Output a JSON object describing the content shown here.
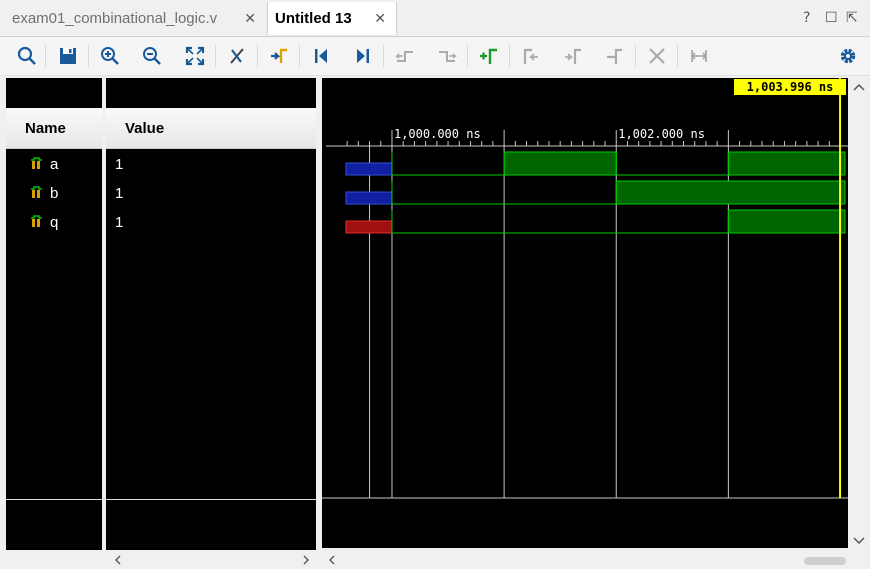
{
  "tabs": [
    {
      "label": "exam01_combinational_logic.v",
      "active": false
    },
    {
      "label": "Untitled 13",
      "active": true
    }
  ],
  "window_controls": {
    "help": "?",
    "restore": "☐",
    "float": "⇱"
  },
  "toolbar": {
    "icons": [
      "search-icon",
      "save-icon",
      "zoom-in-icon",
      "zoom-out-icon",
      "zoom-fit-icon",
      "marker-cut-icon",
      "go-to-cursor-icon",
      "go-to-start-icon",
      "go-to-end-icon",
      "previous-transition-icon",
      "next-transition-icon",
      "add-marker-icon",
      "previous-marker-icon",
      "next-marker-icon",
      "swap-cursor-icon",
      "delete-marker-icon",
      "expand-icon",
      "settings-icon"
    ]
  },
  "columns": {
    "name": "Name",
    "value": "Value"
  },
  "signals": [
    {
      "name": "a",
      "value": "1",
      "color": "#00c000"
    },
    {
      "name": "b",
      "value": "1",
      "color": "#00c000"
    },
    {
      "name": "q",
      "value": "1",
      "color": "#00c000"
    }
  ],
  "timeline": {
    "ticks": [
      {
        "label": "1,000.000 ns",
        "time": 1000.0
      },
      {
        "label": "1,002.000 ns",
        "time": 1002.0
      }
    ],
    "cursor_label": "1,003.996 ns",
    "cursor_time": 1003.996,
    "view_start": 999.59,
    "view_end": 1004.04,
    "time_unit": "ns",
    "colors": {
      "high": "#00b000",
      "low_line": "#00cc00",
      "unknown_a": "#1020a0",
      "unknown_q": "#a01010",
      "cursor": "#ffff00",
      "grid": "#c8c8c8"
    }
  },
  "waveforms": [
    {
      "signal": "a",
      "segments": [
        {
          "start": 999.59,
          "end": 1000.0,
          "state": "X"
        },
        {
          "start": 1000.0,
          "end": 1001.0,
          "state": "0"
        },
        {
          "start": 1001.0,
          "end": 1002.0,
          "state": "1"
        },
        {
          "start": 1002.0,
          "end": 1003.0,
          "state": "0"
        },
        {
          "start": 1003.0,
          "end": 1004.04,
          "state": "1"
        }
      ]
    },
    {
      "signal": "b",
      "segments": [
        {
          "start": 999.59,
          "end": 1000.0,
          "state": "X"
        },
        {
          "start": 1000.0,
          "end": 1002.0,
          "state": "0"
        },
        {
          "start": 1002.0,
          "end": 1004.04,
          "state": "1"
        }
      ]
    },
    {
      "signal": "q",
      "segments": [
        {
          "start": 999.59,
          "end": 1000.0,
          "state": "XQ"
        },
        {
          "start": 1000.0,
          "end": 1003.0,
          "state": "0"
        },
        {
          "start": 1003.0,
          "end": 1004.04,
          "state": "1"
        }
      ]
    }
  ]
}
